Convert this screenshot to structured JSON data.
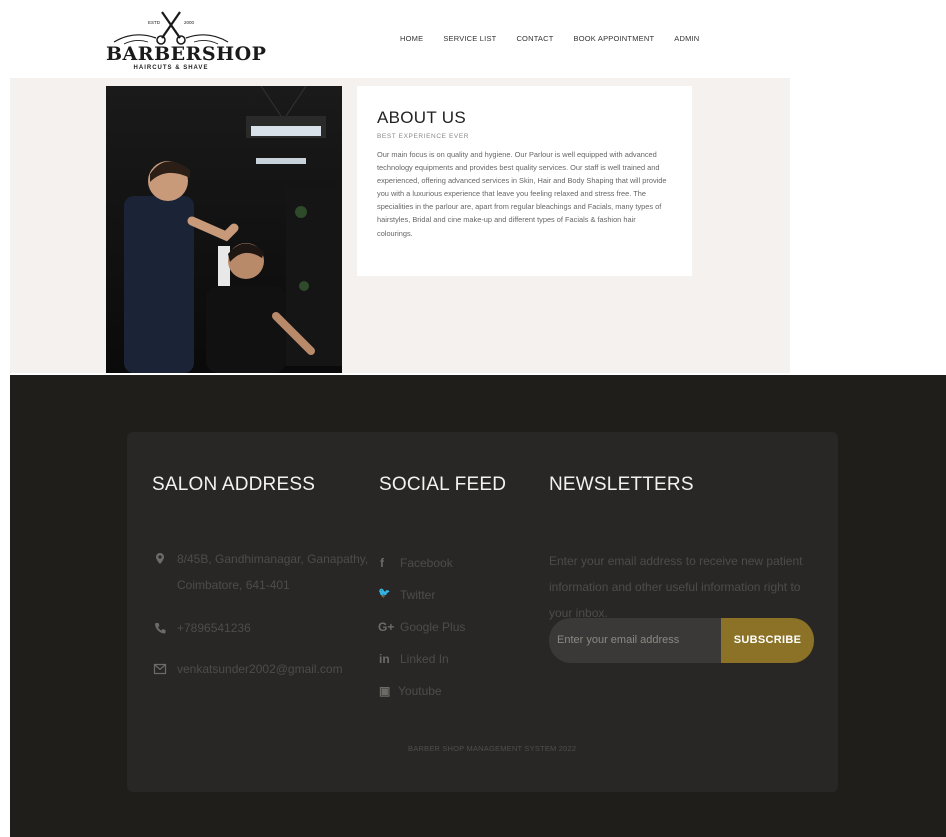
{
  "brand": {
    "est_left": "ESTD",
    "est_right": "2000",
    "name": "BARBERSHOP",
    "tagline": "HAIRCUTS & SHAVE"
  },
  "nav": {
    "items": [
      "HOME",
      "SERVICE LIST",
      "CONTACT",
      "BOOK APPOINTMENT",
      "ADMIN"
    ]
  },
  "about": {
    "title": "ABOUT US",
    "subtitle": "BEST EXPERIENCE EVER",
    "body": "Our main focus is on quality and hygiene. Our Parlour is well equipped with advanced technology equipments and provides best quality services. Our staff is well trained and experienced, offering advanced services in Skin, Hair and Body Shaping that will provide you with a luxurious experience that leave you feeling relaxed and stress free. The specialities in the parlour are, apart from regular bleachings and Facials, many types of hairstyles, Bridal and cine make-up and different types of Facials & fashion hair colourings."
  },
  "footer": {
    "address_title": "SALON ADDRESS",
    "address_line1": "8/45B, Gandhimanagar, Ganapathy,",
    "address_line2": "Coimbatore, 641-401",
    "phone": "+7896541236",
    "email": "venkatsunder2002@gmail.com",
    "social_title": "SOCIAL FEED",
    "social": [
      {
        "icon": "f",
        "label": "Facebook"
      },
      {
        "icon": "🐦",
        "label": "Twitter"
      },
      {
        "icon": "G+",
        "label": "Google Plus"
      },
      {
        "icon": "in",
        "label": "Linked In"
      },
      {
        "icon": "▣",
        "label": "Youtube"
      }
    ],
    "newsletter_title": "NEWSLETTERS",
    "newsletter_text": "Enter your email address to receive new patient information and other useful information right to your inbox.",
    "email_placeholder": "Enter your email address",
    "subscribe_label": "SUBSCRIBE",
    "copyright": "BARBER SHOP MANAGEMENT SYSTEM 2022"
  },
  "colors": {
    "footer_bg": "#1f1e1b",
    "card_bg": "#282725",
    "accent": "#8c7227",
    "about_bg": "#f4f1ee"
  }
}
